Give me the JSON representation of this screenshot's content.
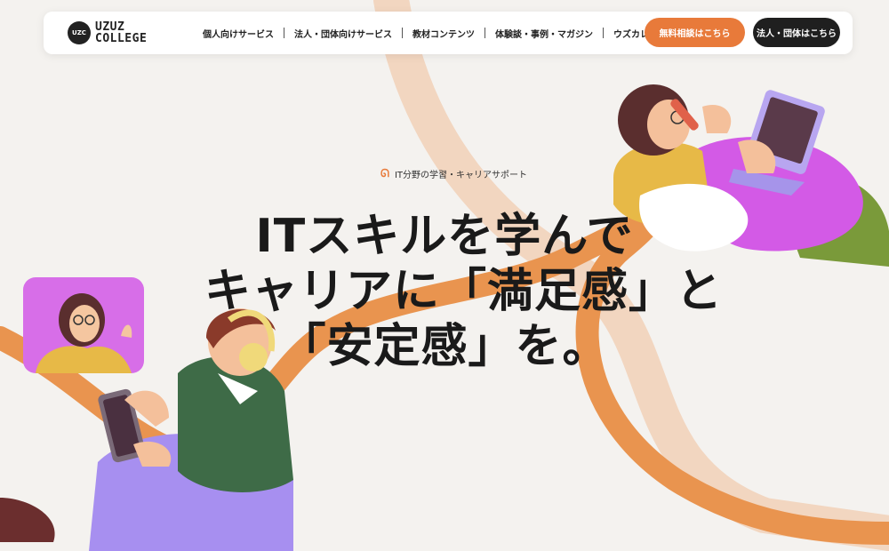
{
  "brand": {
    "logo_mark": "UZC",
    "name_line1": "UZUZ",
    "name_line2": "COLLEGE"
  },
  "nav": {
    "items": [
      {
        "label": "個人向けサービス"
      },
      {
        "label": "法人・団体向けサービス"
      },
      {
        "label": "教材コンテンツ"
      },
      {
        "label": "体験談・事例・マガジン"
      },
      {
        "label": "ウズカレとは"
      }
    ],
    "cta_consult": "無料相談はこちら",
    "cta_corporate": "法人・団体はこちら"
  },
  "hero": {
    "tagline": "IT分野の学習・キャリアサポート",
    "tagline_icon": "swirl-icon",
    "headline_line1": "ITスキルを学んで",
    "headline_line2": "キャリアに「満足感」と",
    "headline_line3": "「安定感」を。"
  },
  "colors": {
    "accent": "#e87a3a",
    "dark": "#1f1f1f",
    "background": "#f4f2ef"
  }
}
